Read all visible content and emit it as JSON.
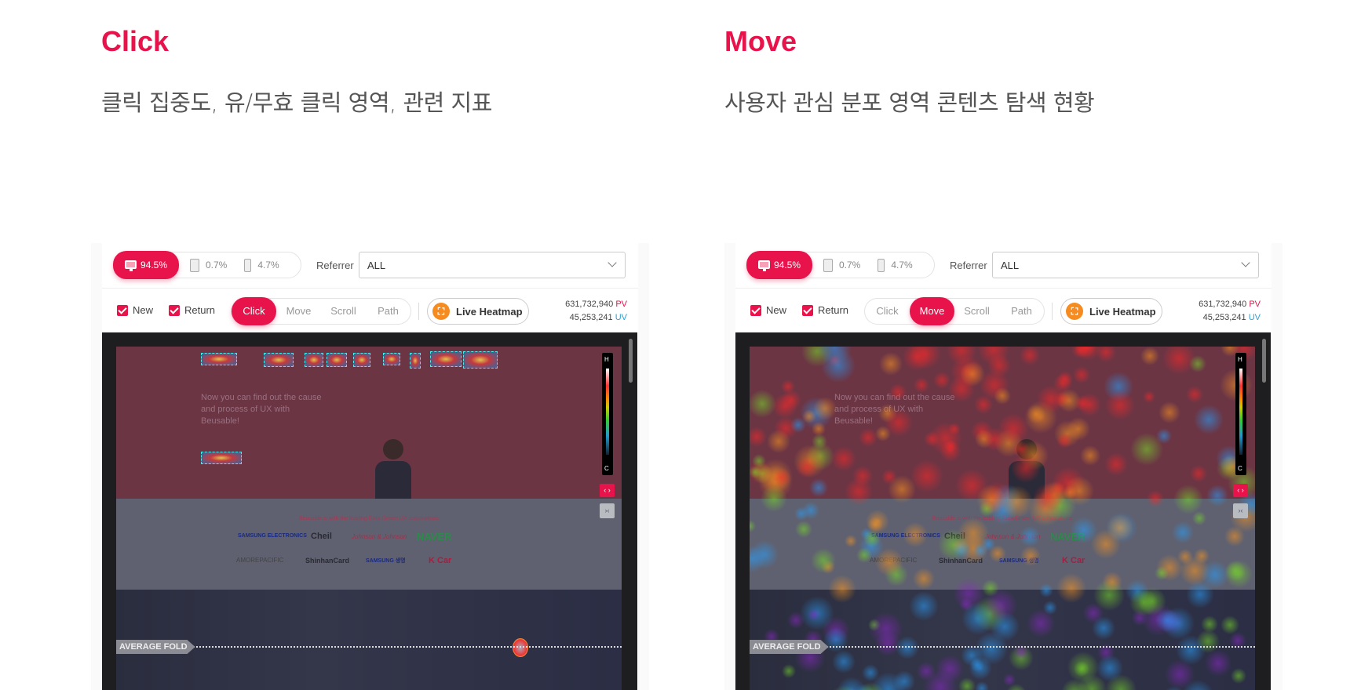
{
  "panels": [
    {
      "title": "Click",
      "subtitle": "클릭 집중도, 유/무효 클릭 영역, 관련 지표",
      "devices": {
        "desktop": "94.5%",
        "tablet": "0.7%",
        "mobile": "4.7%"
      },
      "referrer_label": "Referrer",
      "referrer_value": "ALL",
      "checkboxes": {
        "new": "New",
        "return": "Return"
      },
      "modes": [
        "Click",
        "Move",
        "Scroll",
        "Path"
      ],
      "active_mode": "Click",
      "live_heatmap": "Live Heatmap",
      "pv_value": "631,732,940",
      "pv_label": "PV",
      "uv_value": "45,253,241",
      "uv_label": "UV",
      "hero_text": "Now you can find out the cause and process of UX with Beusable!",
      "logos_heading": "Beusable is with the leading Data-Driven UX corporations",
      "logos": [
        "SAMSUNG ELECTRONICS",
        "Cheil",
        "Johnson & Johnson",
        "NAVER",
        "AMOREPACIFIC",
        "ShinhanCard",
        "SAMSUNG 생명",
        "K Car"
      ],
      "average_fold": "AVERAGE FOLD",
      "legend_hot": "H",
      "legend_cold": "C"
    },
    {
      "title": "Move",
      "subtitle": "사용자 관심 분포 영역 콘텐츠 탐색 현황",
      "devices": {
        "desktop": "94.5%",
        "tablet": "0.7%",
        "mobile": "4.7%"
      },
      "referrer_label": "Referrer",
      "referrer_value": "ALL",
      "checkboxes": {
        "new": "New",
        "return": "Return"
      },
      "modes": [
        "Click",
        "Move",
        "Scroll",
        "Path"
      ],
      "active_mode": "Move",
      "live_heatmap": "Live Heatmap",
      "pv_value": "631,732,940",
      "pv_label": "PV",
      "uv_value": "45,253,241",
      "uv_label": "UV",
      "hero_text": "Now you can find out the cause and process of UX with Beusable!",
      "logos_heading": "Beusable is with the leading Data-Driven UX corporations",
      "logos": [
        "SAMSUNG ELECTRONICS",
        "Cheil",
        "Johnson & Johnson",
        "NAVER",
        "AMOREPACIFIC",
        "ShinhanCard",
        "SAMSUNG 생명",
        "K Car"
      ],
      "average_fold": "AVERAGE FOLD",
      "legend_hot": "H",
      "legend_cold": "C"
    }
  ],
  "colors": {
    "accent": "#e8134b",
    "pv": "#e8134b",
    "uv": "#29a3d6",
    "live_icon": "#f68b1f"
  }
}
